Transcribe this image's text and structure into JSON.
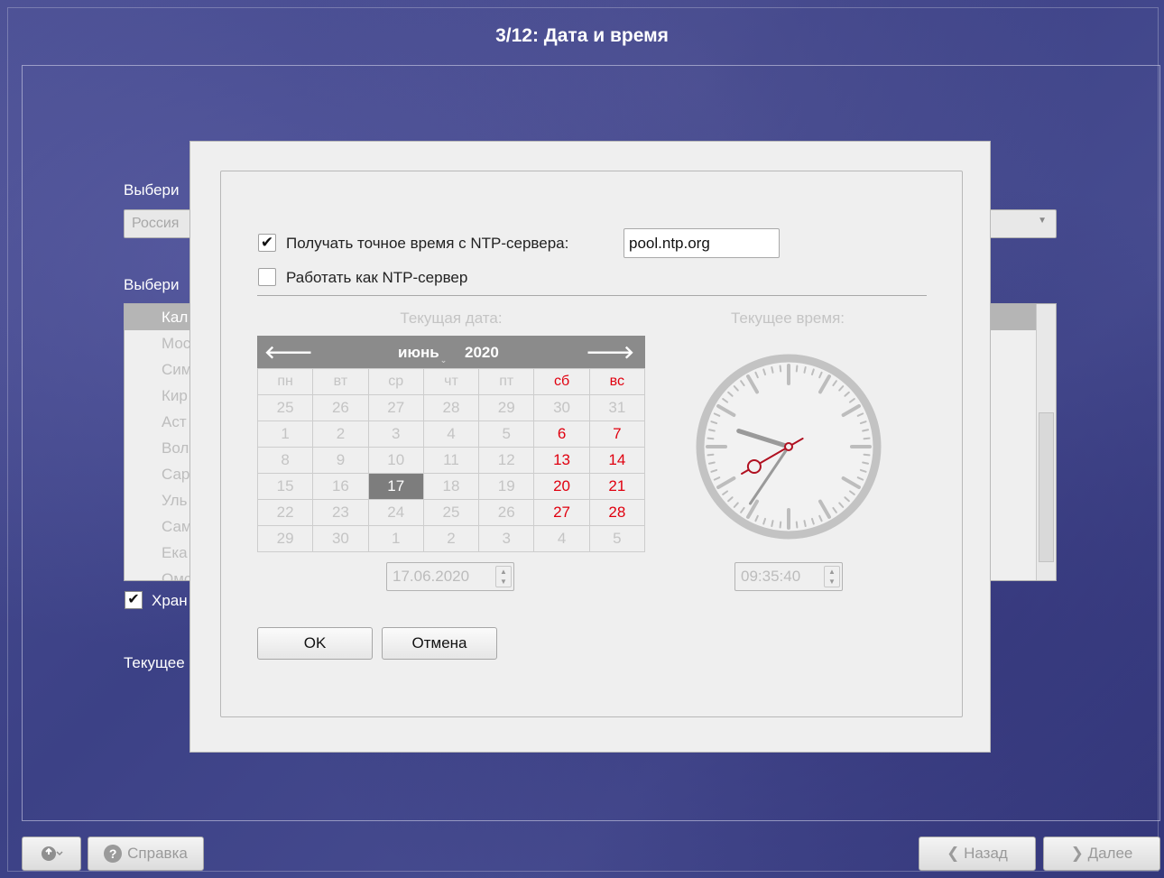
{
  "window": {
    "title": "3/12: Дата и время"
  },
  "background": {
    "label_region": "Выбери",
    "region_value": "Россия",
    "label_zone": "Выбери",
    "zone_items": [
      "Кал",
      "Мос",
      "Сим",
      "Кир",
      "Аст",
      "Вол",
      "Сар",
      "Уль",
      "Сам",
      "Ека",
      "Омс"
    ],
    "store_label": "Хран",
    "store_checked": "✔",
    "current_label": "Текущее"
  },
  "bottom_bar": {
    "help_label": "Справка",
    "help_icon": "?",
    "back_label": "❮ Назад",
    "next_label": "❯ Далее"
  },
  "dialog": {
    "ntp_checkbox_label": "Получать точное время с NTP-сервера:",
    "ntp_checkbox_mark": "✔",
    "ntp_server_value": "pool.ntp.org",
    "ntp_server_mode_label": "Работать как NTP-сервер",
    "date_caption": "Текущая дата:",
    "time_caption": "Текущее время:",
    "calendar": {
      "prev_icon": "🡐",
      "next_icon": "🡒",
      "month": "июнь",
      "month_caret": "⌄",
      "year": "2020",
      "weekdays": [
        "пн",
        "вт",
        "ср",
        "чт",
        "пт",
        "сб",
        "вс"
      ],
      "weeks": [
        [
          "25",
          "26",
          "27",
          "28",
          "29",
          "30",
          "31"
        ],
        [
          "1",
          "2",
          "3",
          "4",
          "5",
          "6",
          "7"
        ],
        [
          "8",
          "9",
          "10",
          "11",
          "12",
          "13",
          "14"
        ],
        [
          "15",
          "16",
          "17",
          "18",
          "19",
          "20",
          "21"
        ],
        [
          "22",
          "23",
          "24",
          "25",
          "26",
          "27",
          "28"
        ],
        [
          "29",
          "30",
          "1",
          "2",
          "3",
          "4",
          "5"
        ]
      ],
      "selected_day": "17"
    },
    "date_value": "17.06.2020",
    "time_value": "09:35:40",
    "ok_label": "OK",
    "cancel_label": "Отмена"
  },
  "colors": {
    "weekend_red": "#e0000f",
    "dimmed_text": "#c4c4c4",
    "selected_day_bg": "#7d7d7d",
    "clock_second_hand": "#b01020"
  }
}
